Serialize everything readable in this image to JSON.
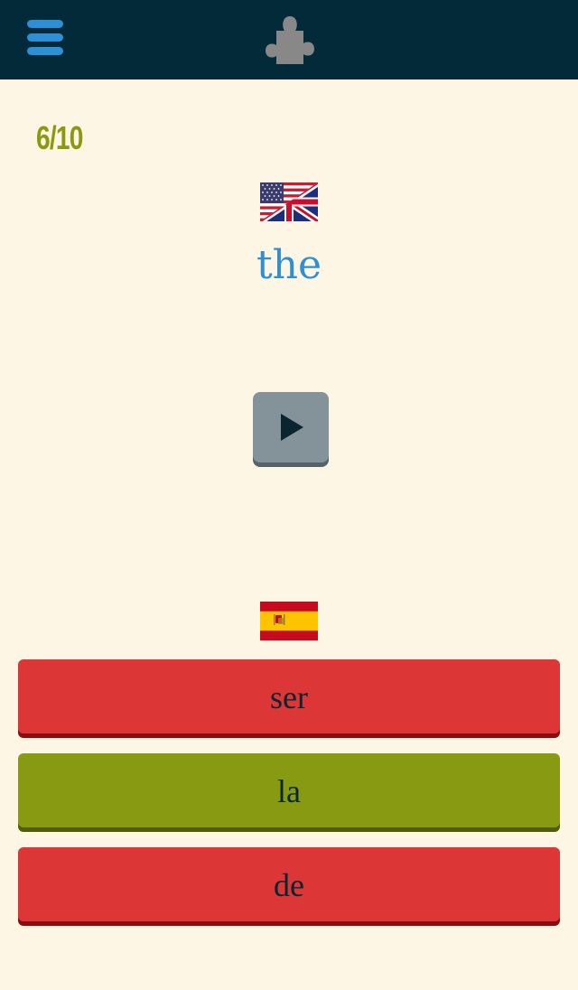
{
  "header": {
    "menu_icon": "hamburger-menu-icon",
    "center_icon": "puzzle-piece-icon",
    "background_color": "#022a38",
    "menu_color": "#2d8fd5",
    "puzzle_color": "#888888"
  },
  "quiz": {
    "progress": "6/10",
    "source_language_flag": "us-uk-flag-icon",
    "prompt_word": "the",
    "play_button_icon": "play-icon",
    "target_language_flag": "spain-flag-icon",
    "answers": [
      {
        "label": "ser",
        "state": "wrong",
        "color": "#dc3636"
      },
      {
        "label": "la",
        "state": "correct",
        "color": "#879a12"
      },
      {
        "label": "de",
        "state": "wrong",
        "color": "#dc3636"
      }
    ]
  }
}
